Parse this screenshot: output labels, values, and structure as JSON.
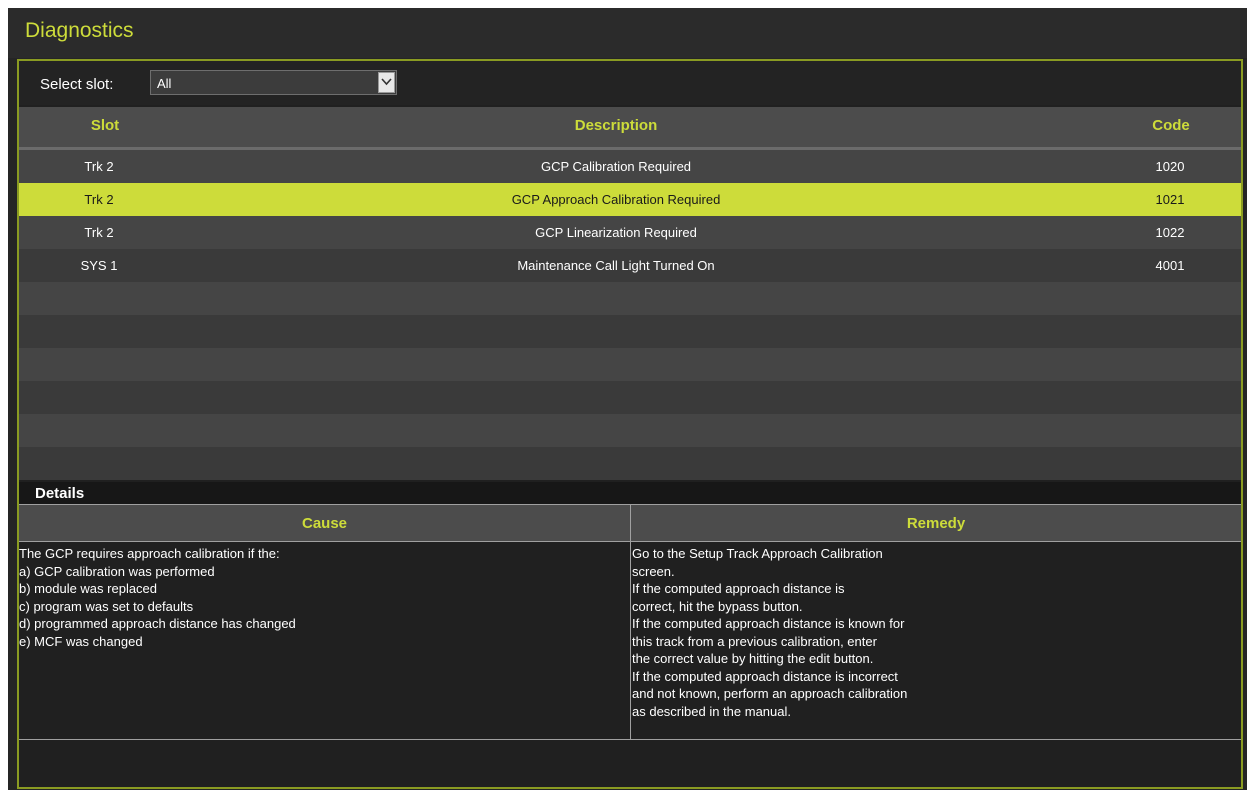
{
  "window": {
    "title": "Diagnostics"
  },
  "filter": {
    "label": "Select slot:",
    "selected": "All"
  },
  "table": {
    "headers": {
      "slot": "Slot",
      "description": "Description",
      "code": "Code"
    },
    "rows": [
      {
        "slot": "Trk 2",
        "description": "GCP Calibration Required",
        "code": "1020"
      },
      {
        "slot": "Trk 2",
        "description": "GCP Approach Calibration Required",
        "code": "1021"
      },
      {
        "slot": "Trk 2",
        "description": "GCP Linearization Required",
        "code": "1022"
      },
      {
        "slot": "SYS 1",
        "description": "Maintenance Call Light Turned On",
        "code": "4001"
      }
    ],
    "selected_row": 1
  },
  "details": {
    "title": "Details",
    "cause_header": "Cause",
    "remedy_header": "Remedy",
    "cause_lines": [
      "The GCP requires approach calibration if the:",
      "a) GCP calibration was performed",
      "b) module was replaced",
      "c) program was set to defaults",
      "d) programmed approach distance has changed",
      "e) MCF was changed"
    ],
    "remedy_lines": [
      "Go to the Setup Track Approach Calibration",
      "screen.",
      "If the computed approach distance is",
      "correct, hit the bypass button.",
      "If the computed approach distance is known for",
      "this track from a previous calibration, enter",
      "the correct value by hitting the edit button.",
      "If the computed approach distance is incorrect",
      "and not known, perform an approach calibration",
      "as described in the manual."
    ]
  },
  "colors": {
    "accent": "#cddc3a",
    "border": "#8a9b22",
    "background": "#252525"
  },
  "icons": {
    "dropdown": "chevron-down-icon"
  }
}
